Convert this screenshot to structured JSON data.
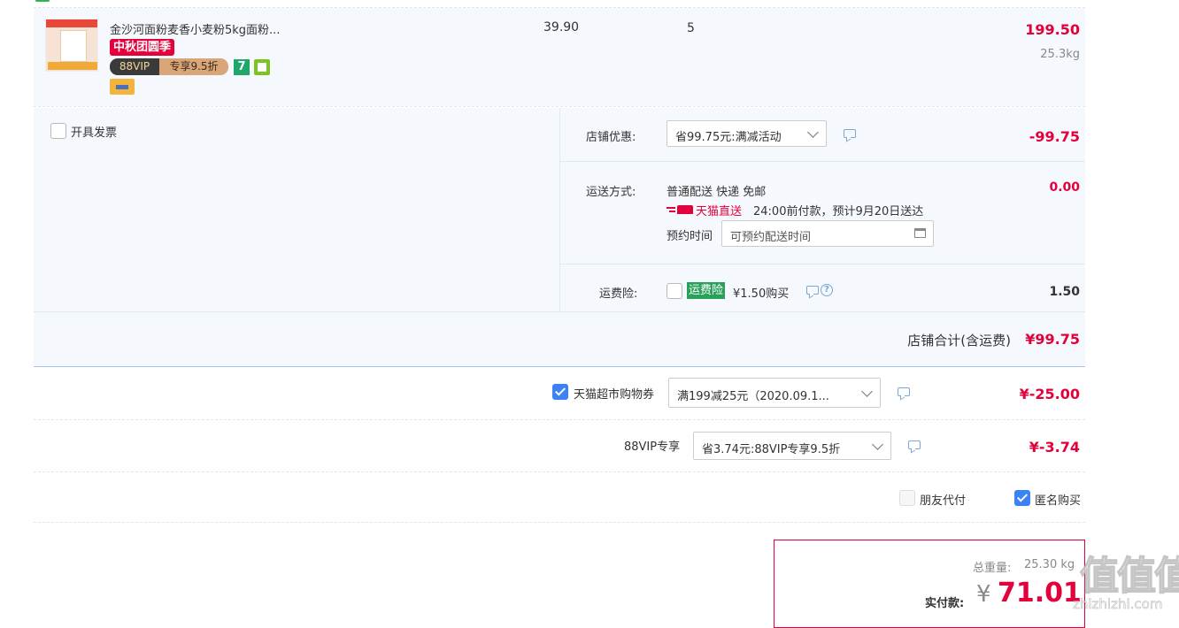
{
  "product": {
    "title": "金沙河面粉麦香小麦粉5kg面粉...",
    "tag_promo": "中秋团圆季",
    "vip_tag": "88VIP",
    "vip_discount": "专享9.5折",
    "badge_7": "7",
    "unit_price": "39.90",
    "quantity": "5",
    "subtotal": "199.50",
    "weight": "25.3kg"
  },
  "invoice": {
    "label": "开具发票"
  },
  "shop_discount": {
    "label": "店铺优惠:",
    "select_value": "省99.75元:满减活动",
    "amount": "-99.75"
  },
  "shipping": {
    "label": "运送方式:",
    "method": "普通配送 快递 免邮",
    "brand": "天猫直送",
    "delivery_note": "24:00前付款，预计9月20日送达",
    "appointment_label": "预约时间",
    "appointment_placeholder": "可预约配送时间",
    "amount": "0.00"
  },
  "insurance": {
    "label": "运费险:",
    "badge": "运费险",
    "price_text": "¥1.50购买",
    "amount": "1.50"
  },
  "shop_total": {
    "label": "店铺合计(含运费)",
    "amount": "¥99.75"
  },
  "coupon": {
    "label": "天猫超市购物券",
    "select_value": "满199减25元（2020.09.1...",
    "amount": "¥-25.00"
  },
  "vip": {
    "label": "88VIP专享",
    "select_value": "省3.74元:88VIP专享9.5折",
    "amount": "¥-3.74"
  },
  "options": {
    "friend_pay": "朋友代付",
    "anonymous": "匿名购买"
  },
  "summary": {
    "weight_label": "总重量:",
    "weight_value": "25.30 kg",
    "pay_label": "实付款:",
    "currency": "¥",
    "pay_amount": "71.01"
  },
  "watermark": {
    "text": "值值值",
    "url": "zhizhizhi.com"
  },
  "colors": {
    "accent_red": "#e4003a",
    "panel_bg": "#f5f8fd",
    "check_blue": "#3b82f6",
    "insurance_green": "#2aa15a"
  }
}
